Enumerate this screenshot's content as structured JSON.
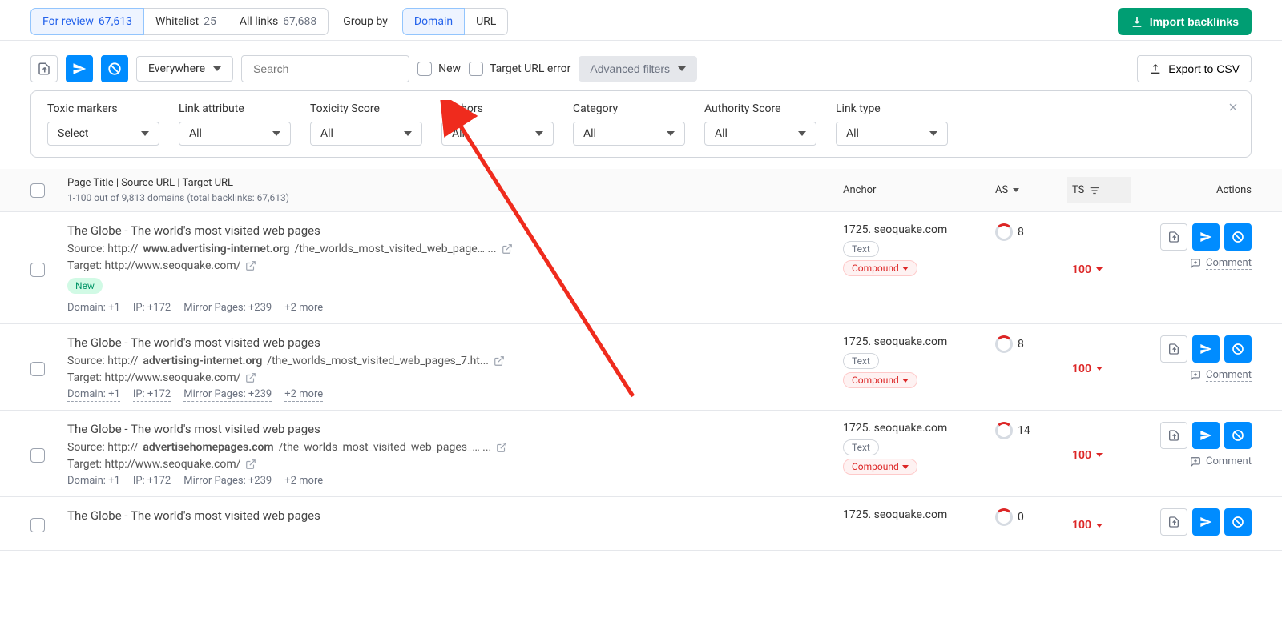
{
  "tabs": {
    "review": {
      "label": "For review",
      "count": "67,613"
    },
    "whitelist": {
      "label": "Whitelist",
      "count": "25"
    },
    "all": {
      "label": "All links",
      "count": "67,688"
    }
  },
  "groupby": {
    "label": "Group by",
    "opt_domain": "Domain",
    "opt_url": "URL"
  },
  "import": "Import backlinks",
  "toolbar": {
    "everywhere": "Everywhere",
    "search_placeholder": "Search",
    "new": "New",
    "target_err": "Target URL error",
    "advanced": "Advanced filters",
    "export": "Export to CSV"
  },
  "filters": {
    "toxic": {
      "label": "Toxic markers",
      "value": "Select"
    },
    "linkattr": {
      "label": "Link attribute",
      "value": "All"
    },
    "toxscore": {
      "label": "Toxicity Score",
      "value": "All"
    },
    "anchors": {
      "label": "Anchors",
      "value": "All"
    },
    "category": {
      "label": "Category",
      "value": "All"
    },
    "auth": {
      "label": "Authority Score",
      "value": "All"
    },
    "linktype": {
      "label": "Link type",
      "value": "All"
    }
  },
  "head": {
    "main_title": "Page Title | Source URL | Target URL",
    "main_sub": "1-100 out of 9,813 domains (total backlinks: 67,613)",
    "anchor": "Anchor",
    "as": "AS",
    "ts": "TS",
    "actions": "Actions"
  },
  "rows": [
    {
      "title": "The Globe - The world's most visited web pages",
      "source_prefix": "http://",
      "source_bold": "www.advertising-internet.org",
      "source_rest": "/the_worlds_most_visited_web_page… ...",
      "target": "http://www.seoquake.com/",
      "is_new": true,
      "anchor": "1725. seoquake.com",
      "as": "8",
      "ts": "100",
      "domain": "+1",
      "ip": "+172",
      "mirror": "+239",
      "more": "+2 more"
    },
    {
      "title": "The Globe - The world's most visited web pages",
      "source_prefix": "http://",
      "source_bold": "advertising-internet.org",
      "source_rest": "/the_worlds_most_visited_web_pages_7.ht...",
      "target": "http://www.seoquake.com/",
      "is_new": false,
      "anchor": "1725. seoquake.com",
      "as": "8",
      "ts": "100",
      "domain": "+1",
      "ip": "+172",
      "mirror": "+239",
      "more": "+2 more"
    },
    {
      "title": "The Globe - The world's most visited web pages",
      "source_prefix": "http://",
      "source_bold": "advertisehomepages.com",
      "source_rest": "/the_worlds_most_visited_web_pages_… ...",
      "target": "http://www.seoquake.com/",
      "is_new": false,
      "anchor": "1725. seoquake.com",
      "as": "14",
      "ts": "100",
      "domain": "+1",
      "ip": "+172",
      "mirror": "+239",
      "more": "+2 more"
    },
    {
      "title": "The Globe - The world's most visited web pages",
      "source_prefix": "",
      "source_bold": "",
      "source_rest": "",
      "target": "",
      "is_new": false,
      "anchor": "1725. seoquake.com",
      "as": "0",
      "ts": "100",
      "domain": "",
      "ip": "",
      "mirror": "",
      "more": ""
    }
  ],
  "labels": {
    "source": "Source:",
    "target": "Target:",
    "domain": "Domain:",
    "ip": "IP:",
    "mirror": "Mirror Pages:",
    "new_badge": "New",
    "text_chip": "Text",
    "compound_chip": "Compound",
    "comment": "Comment"
  }
}
